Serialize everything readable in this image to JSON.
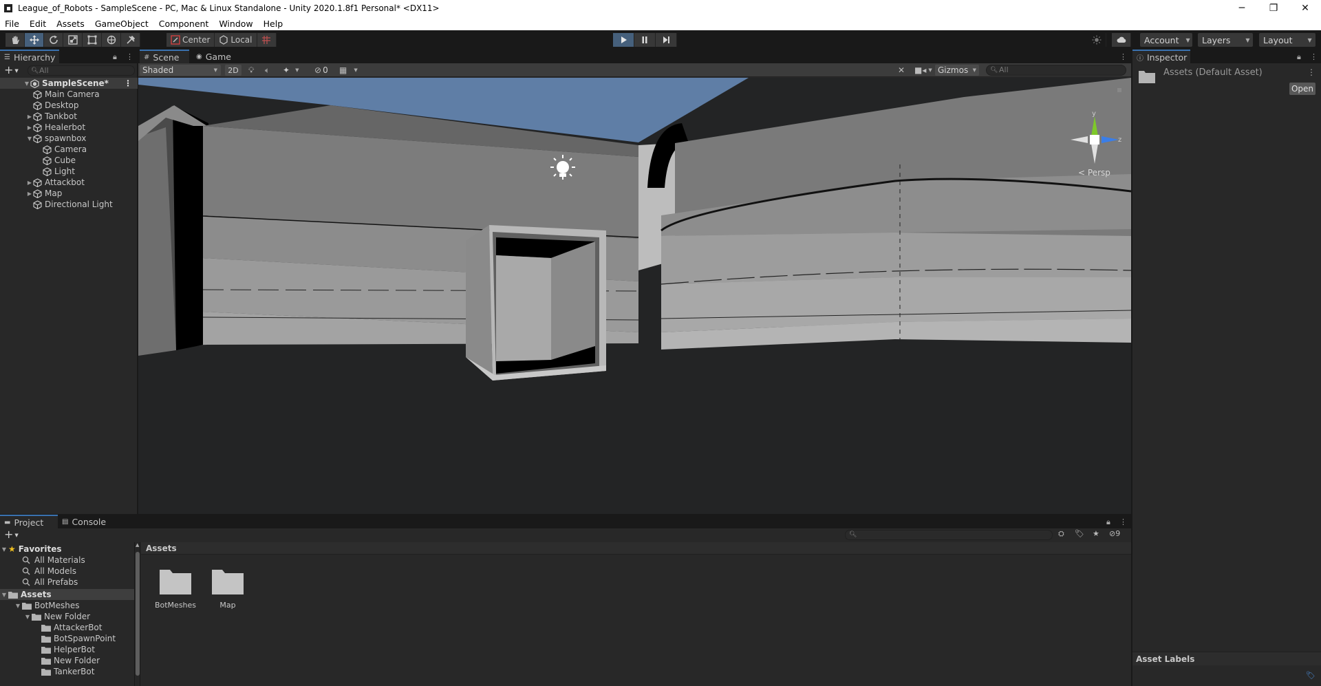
{
  "window": {
    "title": "League_of_Robots - SampleScene - PC, Mac & Linux Standalone - Unity 2020.1.8f1 Personal* <DX11>",
    "minimize": "─",
    "restore": "❐",
    "close": "✕"
  },
  "menu": [
    "File",
    "Edit",
    "Assets",
    "GameObject",
    "Component",
    "Window",
    "Help"
  ],
  "toolbar": {
    "pivot": "Center",
    "space": "Local",
    "account": "Account",
    "layers": "Layers",
    "layout": "Layout"
  },
  "hierarchy": {
    "tab": "Hierarchy",
    "search_placeholder": "All",
    "scene": "SampleScene*",
    "items": [
      {
        "label": "Main Camera",
        "depth": 1,
        "expand": ""
      },
      {
        "label": "Desktop",
        "depth": 1,
        "expand": ""
      },
      {
        "label": "Tankbot",
        "depth": 1,
        "expand": "▶"
      },
      {
        "label": "Healerbot",
        "depth": 1,
        "expand": "▶"
      },
      {
        "label": "spawnbox",
        "depth": 1,
        "expand": "▼"
      },
      {
        "label": "Camera",
        "depth": 2,
        "expand": ""
      },
      {
        "label": "Cube",
        "depth": 2,
        "expand": ""
      },
      {
        "label": "Light",
        "depth": 2,
        "expand": ""
      },
      {
        "label": "Attackbot",
        "depth": 1,
        "expand": "▶"
      },
      {
        "label": "Map",
        "depth": 1,
        "expand": "▶"
      },
      {
        "label": "Directional Light",
        "depth": 1,
        "expand": ""
      }
    ]
  },
  "scene_view": {
    "tabs": [
      "Scene",
      "Game"
    ],
    "shading": "Shaded",
    "mode_2d": "2D",
    "hidden_count": "0",
    "gizmos": "Gizmos",
    "search_placeholder": "All",
    "projection": "Persp",
    "axis_y": "y",
    "axis_z": "z"
  },
  "inspector": {
    "tab": "Inspector",
    "asset_title": "Assets (Default Asset)",
    "open_button": "Open",
    "asset_labels": "Asset Labels"
  },
  "project": {
    "tabs": [
      "Project",
      "Console"
    ],
    "hidden_count": "9",
    "favorites_header": "Favorites",
    "favorites": [
      "All Materials",
      "All Models",
      "All Prefabs"
    ],
    "assets_header": "Assets",
    "tree": [
      {
        "label": "BotMeshes",
        "depth": 1,
        "expand": "▼"
      },
      {
        "label": "New Folder",
        "depth": 2,
        "expand": "▼"
      },
      {
        "label": "AttackerBot",
        "depth": 3,
        "expand": ""
      },
      {
        "label": "BotSpawnPoint",
        "depth": 3,
        "expand": ""
      },
      {
        "label": "HelperBot",
        "depth": 3,
        "expand": ""
      },
      {
        "label": "New Folder",
        "depth": 3,
        "expand": ""
      },
      {
        "label": "TankerBot",
        "depth": 3,
        "expand": ""
      }
    ],
    "breadcrumb": "Assets",
    "assets": [
      "BotMeshes",
      "Map"
    ]
  },
  "colors": {
    "accent": "#3a72b0",
    "play_active": "#46607c"
  }
}
